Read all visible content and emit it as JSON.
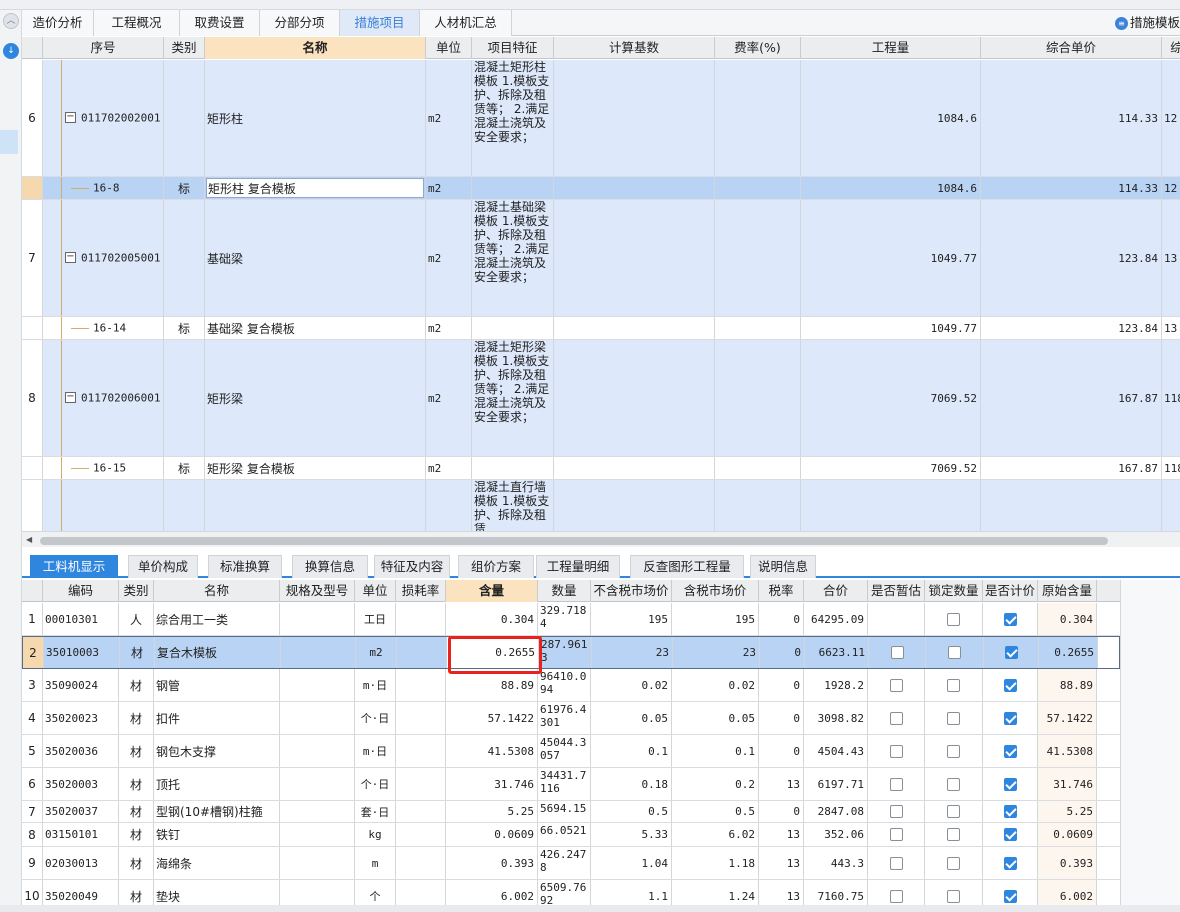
{
  "tabs": [
    "造价分析",
    "工程概况",
    "取费设置",
    "分部分项",
    "措施项目",
    "人材机汇总"
  ],
  "active_tab": 4,
  "tab_right_label": "措施模板",
  "upper_headers": [
    "序号",
    "类别",
    "名称",
    "单位",
    "项目特征",
    "计算基数",
    "费率(%)",
    "工程量",
    "综合单价",
    "综"
  ],
  "upper_rows": [
    {
      "seq": "6",
      "code": "011702002001",
      "type": "",
      "name": "矩形柱",
      "unit": "m2",
      "feature": "混凝土矩形柱模板\n1.模板支护、拆除及租赁等；\n2.满足混凝土浇筑及安全要求；",
      "qty": "1084.6",
      "price": "114.33",
      "extra": "12"
    },
    {
      "seq": "",
      "code": "16-8",
      "type": "标",
      "name": "矩形柱 复合模板",
      "unit": "m2",
      "feature": "",
      "qty": "1084.6",
      "price": "114.33",
      "extra": "12"
    },
    {
      "seq": "7",
      "code": "011702005001",
      "type": "",
      "name": "基础梁",
      "unit": "m2",
      "feature": "混凝土基础梁模板\n1.模板支护、拆除及租赁等；\n2.满足混凝土浇筑及安全要求；",
      "qty": "1049.77",
      "price": "123.84",
      "extra": "13"
    },
    {
      "seq": "",
      "code": "16-14",
      "type": "标",
      "name": "基础梁 复合模板",
      "unit": "m2",
      "feature": "",
      "qty": "1049.77",
      "price": "123.84",
      "extra": "13"
    },
    {
      "seq": "8",
      "code": "011702006001",
      "type": "",
      "name": "矩形梁",
      "unit": "m2",
      "feature": "混凝土矩形梁模板\n1.模板支护、拆除及租赁等；\n2.满足混凝土浇筑及安全要求；",
      "qty": "7069.52",
      "price": "167.87",
      "extra": "118"
    },
    {
      "seq": "",
      "code": "16-15",
      "type": "标",
      "name": "矩形梁 复合模板",
      "unit": "m2",
      "feature": "",
      "qty": "7069.52",
      "price": "167.87",
      "extra": "118"
    },
    {
      "seq": "",
      "code": "",
      "type": "",
      "name": "",
      "unit": "",
      "feature": "混凝土直行墙模板\n1.模板支护、拆除及租赁",
      "qty": "",
      "price": "",
      "extra": ""
    }
  ],
  "bottom_tabs": [
    "工料机显示",
    "单价构成",
    "标准换算",
    "换算信息",
    "特征及内容",
    "组价方案",
    "工程量明细",
    "反查图形工程量",
    "说明信息"
  ],
  "lower_headers": [
    "编码",
    "类别",
    "名称",
    "规格及型号",
    "单位",
    "损耗率",
    "含量",
    "数量",
    "不含税市场价",
    "含税市场价",
    "税率",
    "合价",
    "是否暂估",
    "锁定数量",
    "是否计价",
    "原始含量"
  ],
  "lower_rows": [
    {
      "n": "1",
      "code": "00010301",
      "type": "人",
      "name": "综合用工一类",
      "spec": "",
      "unit": "工日",
      "loss": "",
      "content": "0.304",
      "amount": "329.7184",
      "p_ex": "195",
      "p_in": "195",
      "tax": "0",
      "total": "64295.09",
      "est": "",
      "lock": false,
      "priced": true,
      "orig": "0.304"
    },
    {
      "n": "2",
      "code": "35010003",
      "type": "材",
      "name": "复合木模板",
      "spec": "",
      "unit": "m2",
      "loss": "",
      "content": "0.2655",
      "amount": "287.9613",
      "p_ex": "23",
      "p_in": "23",
      "tax": "0",
      "total": "6623.11",
      "est": false,
      "lock": false,
      "priced": true,
      "orig": "0.2655"
    },
    {
      "n": "3",
      "code": "35090024",
      "type": "材",
      "name": "钢管",
      "spec": "",
      "unit": "m·日",
      "loss": "",
      "content": "88.89",
      "amount": "96410.094",
      "p_ex": "0.02",
      "p_in": "0.02",
      "tax": "0",
      "total": "1928.2",
      "est": false,
      "lock": false,
      "priced": true,
      "orig": "88.89"
    },
    {
      "n": "4",
      "code": "35020023",
      "type": "材",
      "name": "扣件",
      "spec": "",
      "unit": "个·日",
      "loss": "",
      "content": "57.1422",
      "amount": "61976.4301",
      "p_ex": "0.05",
      "p_in": "0.05",
      "tax": "0",
      "total": "3098.82",
      "est": false,
      "lock": false,
      "priced": true,
      "orig": "57.1422"
    },
    {
      "n": "5",
      "code": "35020036",
      "type": "材",
      "name": "钢包木支撑",
      "spec": "",
      "unit": "m·日",
      "loss": "",
      "content": "41.5308",
      "amount": "45044.3057",
      "p_ex": "0.1",
      "p_in": "0.1",
      "tax": "0",
      "total": "4504.43",
      "est": false,
      "lock": false,
      "priced": true,
      "orig": "41.5308"
    },
    {
      "n": "6",
      "code": "35020003",
      "type": "材",
      "name": "顶托",
      "spec": "",
      "unit": "个·日",
      "loss": "",
      "content": "31.746",
      "amount": "34431.7116",
      "p_ex": "0.18",
      "p_in": "0.2",
      "tax": "13",
      "total": "6197.71",
      "est": false,
      "lock": false,
      "priced": true,
      "orig": "31.746"
    },
    {
      "n": "7",
      "code": "35020037",
      "type": "材",
      "name": "型钢(10#槽钢)柱箍",
      "spec": "",
      "unit": "套·日",
      "loss": "",
      "content": "5.25",
      "amount": "5694.15",
      "p_ex": "0.5",
      "p_in": "0.5",
      "tax": "0",
      "total": "2847.08",
      "est": false,
      "lock": false,
      "priced": true,
      "orig": "5.25"
    },
    {
      "n": "8",
      "code": "03150101",
      "type": "材",
      "name": "铁钉",
      "spec": "",
      "unit": "kg",
      "loss": "",
      "content": "0.0609",
      "amount": "66.0521",
      "p_ex": "5.33",
      "p_in": "6.02",
      "tax": "13",
      "total": "352.06",
      "est": false,
      "lock": false,
      "priced": true,
      "orig": "0.0609"
    },
    {
      "n": "9",
      "code": "02030013",
      "type": "材",
      "name": "海绵条",
      "spec": "",
      "unit": "m",
      "loss": "",
      "content": "0.393",
      "amount": "426.2478",
      "p_ex": "1.04",
      "p_in": "1.18",
      "tax": "13",
      "total": "443.3",
      "est": false,
      "lock": false,
      "priced": true,
      "orig": "0.393"
    },
    {
      "n": "10",
      "code": "35020049",
      "type": "材",
      "name": "垫块",
      "spec": "",
      "unit": "个",
      "loss": "",
      "content": "6.002",
      "amount": "6509.7692",
      "p_ex": "1.1",
      "p_in": "1.24",
      "tax": "13",
      "total": "7160.75",
      "est": false,
      "lock": false,
      "priced": true,
      "orig": "6.002"
    }
  ],
  "colors": {
    "accent": "#2f86df",
    "selected_row": "#b9d3f4",
    "header_highlight": "#fbe3bf",
    "annotation_box": "#e8231d"
  }
}
